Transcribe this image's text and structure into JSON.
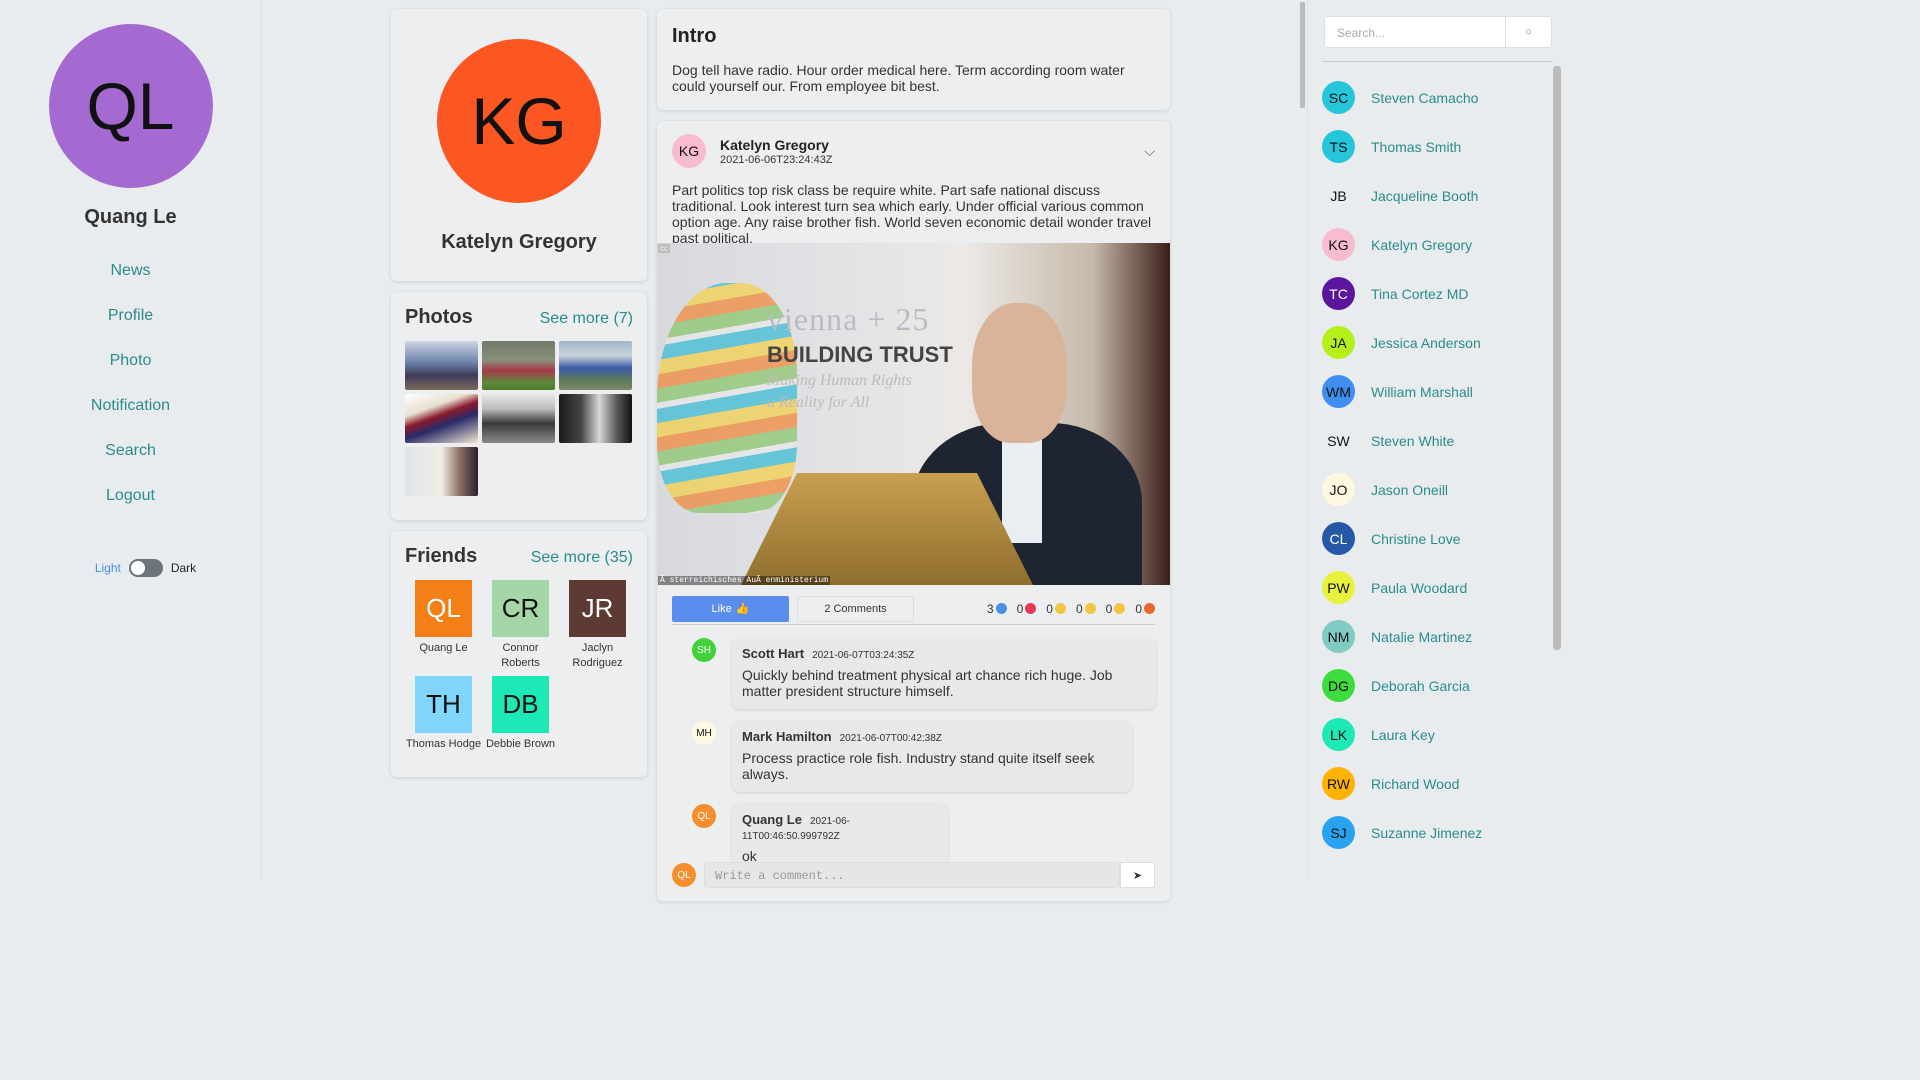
{
  "left_sidebar": {
    "avatar_initials": "QL",
    "avatar_color": "#a46ad1",
    "user_name": "Quang Le",
    "nav": [
      "News",
      "Profile",
      "Photo",
      "Notification",
      "Search",
      "Logout"
    ],
    "theme": {
      "light_label": "Light",
      "dark_label": "Dark"
    }
  },
  "profile": {
    "initials": "KG",
    "avatar_color": "#fc5723",
    "name": "Katelyn Gregory"
  },
  "photos": {
    "title": "Photos",
    "see_more": "See more (7)"
  },
  "friends": {
    "title": "Friends",
    "see_more": "See more (35)",
    "items": [
      {
        "initials": "QL",
        "name": "Quang Le",
        "color": "#f57f17"
      },
      {
        "initials": "CR",
        "name": "Connor Roberts",
        "color": "#a5d6a7"
      },
      {
        "initials": "JR",
        "name": "Jaclyn Rodriguez",
        "color": "#5d3a33"
      },
      {
        "initials": "TH",
        "name": "Thomas Hodge",
        "color": "#81d4fa"
      },
      {
        "initials": "DB",
        "name": "Debbie Brown",
        "color": "#1de9b6"
      }
    ]
  },
  "intro": {
    "title": "Intro",
    "text": "Dog tell have radio. Hour order medical here. Term according room water could yourself our. From employee bit best."
  },
  "post": {
    "author_initials": "KG",
    "author_color": "#f8bbd0",
    "author": "Katelyn Gregory",
    "time": "2021-06-06T23:24:43Z",
    "text": "Part politics top risk class be require white. Part safe national discuss traditional. Look interest turn sea which early. Under official various common option age. Any raise brother fish. World seven economic detail wonder travel past political.",
    "image": {
      "cc": "cc",
      "banner_line1": "vienna + 25",
      "banner_line2": "BUILDING TRUST",
      "banner_line3": "Making Human Rights",
      "banner_line4": "a Reality for All",
      "caption": "Ã sterreichisches AuÃ enministerium"
    },
    "like_label": "Like",
    "comments_label": "2 Comments",
    "reactions": [
      {
        "count": "3",
        "color": "#4a90e2"
      },
      {
        "count": "0",
        "color": "#e53956"
      },
      {
        "count": "0",
        "color": "#f4c542"
      },
      {
        "count": "0",
        "color": "#f4c542"
      },
      {
        "count": "0",
        "color": "#f4c542"
      },
      {
        "count": "0",
        "color": "#e8672d"
      }
    ],
    "comments": [
      {
        "initials": "SH",
        "color": "#43d13c",
        "name": "Scott Hart",
        "time": "2021-06-07T03:24:35Z",
        "text": "Quickly behind treatment physical art chance rich huge. Job matter president structure himself."
      },
      {
        "initials": "MH",
        "color": "#fff8e1",
        "name": "Mark Hamilton",
        "time": "2021-06-07T00:42:38Z",
        "text": "Process practice role fish. Industry stand quite itself seek always."
      },
      {
        "initials": "QL",
        "color": "#f58f2e",
        "name": "Quang Le",
        "time": "2021-06-11T00:46:50.999792Z",
        "text": "ok"
      }
    ],
    "write_initials": "QL",
    "write_placeholder": "Write a comment..."
  },
  "right_sidebar": {
    "search_placeholder": "Search...",
    "users": [
      {
        "initials": "SC",
        "name": "Steven Camacho",
        "color": "#26c6da"
      },
      {
        "initials": "TS",
        "name": "Thomas Smith",
        "color": "#26c6da"
      },
      {
        "initials": "JB",
        "name": "Jacqueline Booth",
        "color": "#e9ecef"
      },
      {
        "initials": "KG",
        "name": "Katelyn Gregory",
        "color": "#f8bbd0"
      },
      {
        "initials": "TC",
        "name": "Tina Cortez MD",
        "color": "#5c169e"
      },
      {
        "initials": "JA",
        "name": "Jessica Anderson",
        "color": "#b6f01c"
      },
      {
        "initials": "WM",
        "name": "William Marshall",
        "color": "#3f8ef2"
      },
      {
        "initials": "SW",
        "name": "Steven White",
        "color": "#e9ecef"
      },
      {
        "initials": "JO",
        "name": "Jason Oneill",
        "color": "#fff8e1"
      },
      {
        "initials": "CL",
        "name": "Christine Love",
        "color": "#2758a6"
      },
      {
        "initials": "PW",
        "name": "Paula Woodard",
        "color": "#e8f23c"
      },
      {
        "initials": "NM",
        "name": "Natalie Martinez",
        "color": "#80cbc4"
      },
      {
        "initials": "DG",
        "name": "Deborah Garcia",
        "color": "#3ddc3d"
      },
      {
        "initials": "LK",
        "name": "Laura Key",
        "color": "#1de9b6"
      },
      {
        "initials": "RW",
        "name": "Richard Wood",
        "color": "#ffb300"
      },
      {
        "initials": "SJ",
        "name": "Suzanne Jimenez",
        "color": "#29a3f0"
      },
      {
        "initials": "",
        "name": "",
        "color": "#3ddc3d"
      }
    ]
  }
}
